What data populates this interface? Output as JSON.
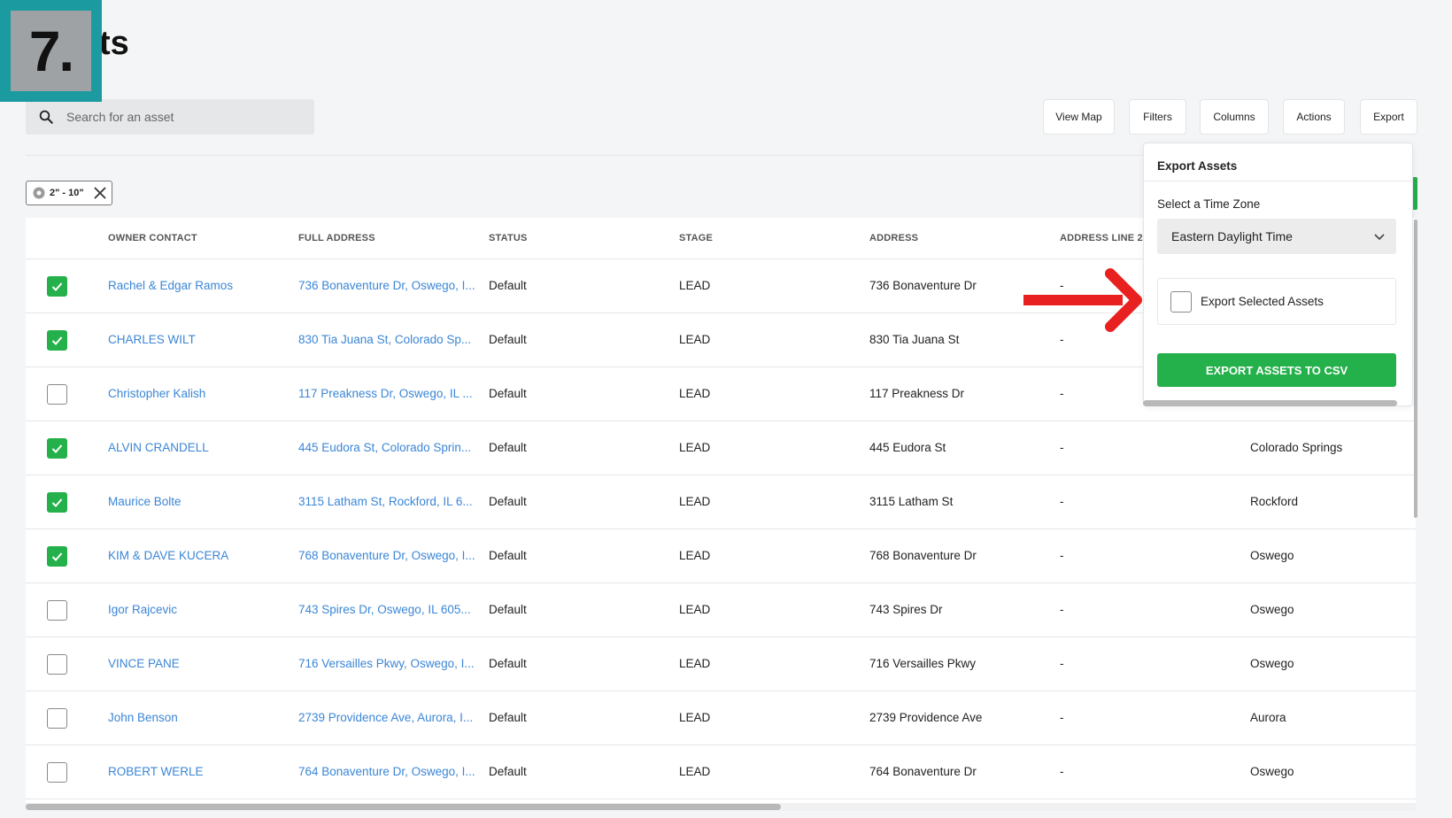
{
  "step_badge": "7.",
  "page_title": "ts",
  "search": {
    "placeholder": "Search for an asset"
  },
  "toolbar": {
    "view_map": "View Map",
    "filters": "Filters",
    "columns": "Columns",
    "actions": "Actions",
    "export": "Export"
  },
  "filter_chip": {
    "label": "2\" - 10\""
  },
  "table": {
    "headers": [
      "OWNER CONTACT",
      "FULL ADDRESS",
      "STATUS",
      "STAGE",
      "ADDRESS",
      "ADDRESS LINE 2"
    ],
    "rows": [
      {
        "checked": true,
        "owner": "Rachel & Edgar Ramos",
        "full_address": "736 Bonaventure Dr, Oswego, I...",
        "status": "Default",
        "stage": "LEAD",
        "address": "736 Bonaventure Dr",
        "line2": "-",
        "city": ""
      },
      {
        "checked": true,
        "owner": "CHARLES WILT",
        "full_address": "830 Tia Juana St, Colorado Sp...",
        "status": "Default",
        "stage": "LEAD",
        "address": "830 Tia Juana St",
        "line2": "-",
        "city": ""
      },
      {
        "checked": false,
        "owner": "Christopher Kalish",
        "full_address": "117 Preakness Dr, Oswego, IL ...",
        "status": "Default",
        "stage": "LEAD",
        "address": "117 Preakness Dr",
        "line2": "-",
        "city": ""
      },
      {
        "checked": true,
        "owner": "ALVIN CRANDELL",
        "full_address": "445 Eudora St, Colorado Sprin...",
        "status": "Default",
        "stage": "LEAD",
        "address": "445 Eudora St",
        "line2": "-",
        "city": "Colorado Springs"
      },
      {
        "checked": true,
        "owner": "Maurice Bolte",
        "full_address": "3115 Latham St, Rockford, IL 6...",
        "status": "Default",
        "stage": "LEAD",
        "address": "3115 Latham St",
        "line2": "-",
        "city": "Rockford"
      },
      {
        "checked": true,
        "owner": "KIM & DAVE KUCERA",
        "full_address": "768 Bonaventure Dr, Oswego, I...",
        "status": "Default",
        "stage": "LEAD",
        "address": "768 Bonaventure Dr",
        "line2": "-",
        "city": "Oswego"
      },
      {
        "checked": false,
        "owner": "Igor Rajcevic",
        "full_address": "743 Spires Dr, Oswego, IL 605...",
        "status": "Default",
        "stage": "LEAD",
        "address": "743 Spires Dr",
        "line2": "-",
        "city": "Oswego"
      },
      {
        "checked": false,
        "owner": "VINCE PANE",
        "full_address": "716 Versailles Pkwy, Oswego, I...",
        "status": "Default",
        "stage": "LEAD",
        "address": "716 Versailles Pkwy",
        "line2": "-",
        "city": "Oswego"
      },
      {
        "checked": false,
        "owner": "John Benson",
        "full_address": "2739 Providence Ave, Aurora, I...",
        "status": "Default",
        "stage": "LEAD",
        "address": "2739 Providence Ave",
        "line2": "-",
        "city": "Aurora"
      },
      {
        "checked": false,
        "owner": "ROBERT WERLE",
        "full_address": "764 Bonaventure Dr, Oswego, I...",
        "status": "Default",
        "stage": "LEAD",
        "address": "764 Bonaventure Dr",
        "line2": "-",
        "city": "Oswego"
      }
    ]
  },
  "export_panel": {
    "title": "Export Assets",
    "timezone_label": "Select a Time Zone",
    "timezone_value": "Eastern Daylight Time",
    "selected_label": "Export Selected Assets",
    "selected_checked": false,
    "button_label": "EXPORT ASSETS TO CSV"
  },
  "colors": {
    "accent_green": "#24b04a",
    "link_blue": "#3b86d6",
    "badge_teal": "#1b9aa0",
    "arrow_red": "#e8201f"
  }
}
